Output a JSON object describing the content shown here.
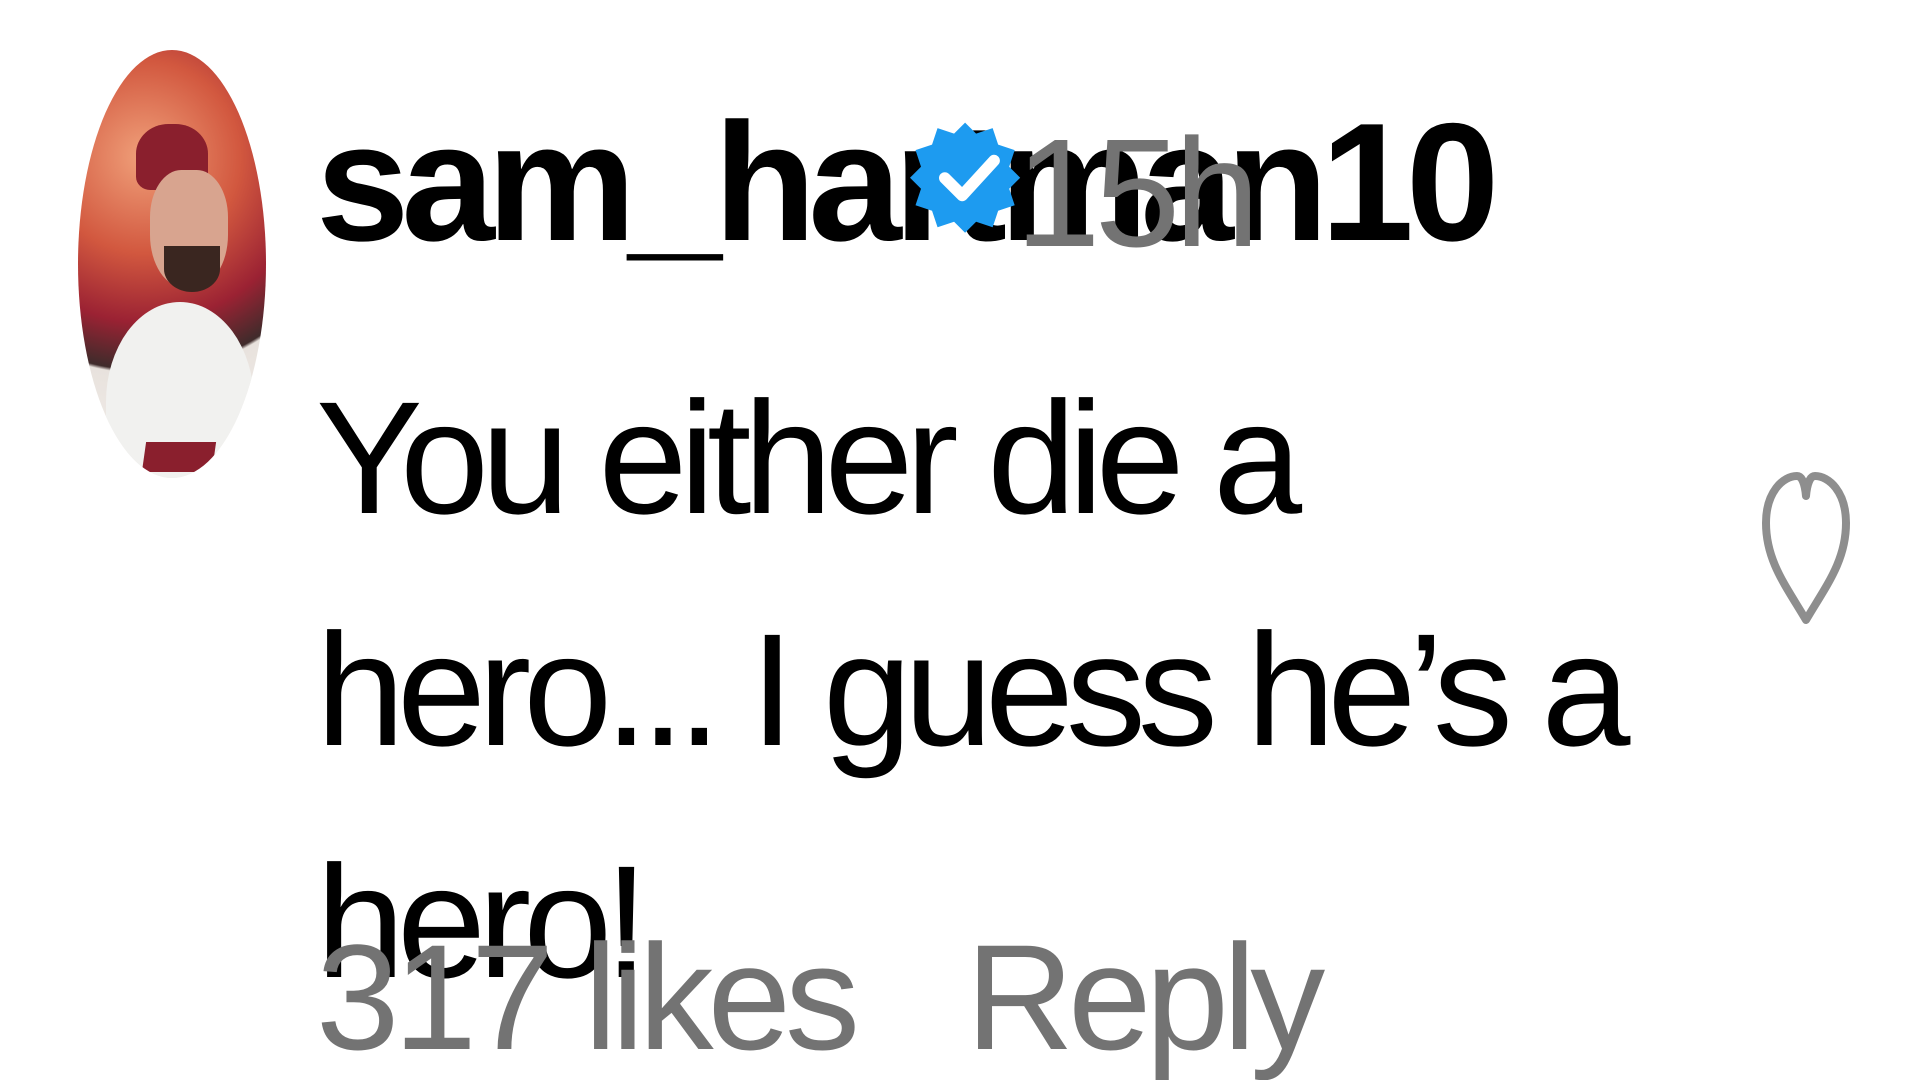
{
  "comment": {
    "username": "sam_hartman10",
    "verified": true,
    "timestamp": "15h",
    "text": "You either die a hero... I guess he’s a hero!",
    "likes": "317 likes",
    "reply_label": "Reply"
  },
  "icons": {
    "verified": "verified-badge-icon",
    "like": "heart-outline-icon"
  },
  "colors": {
    "verified": "#1d9bf0",
    "secondary_text": "#737373",
    "primary_text": "#000000",
    "heart_outline": "#8e8e8e"
  }
}
